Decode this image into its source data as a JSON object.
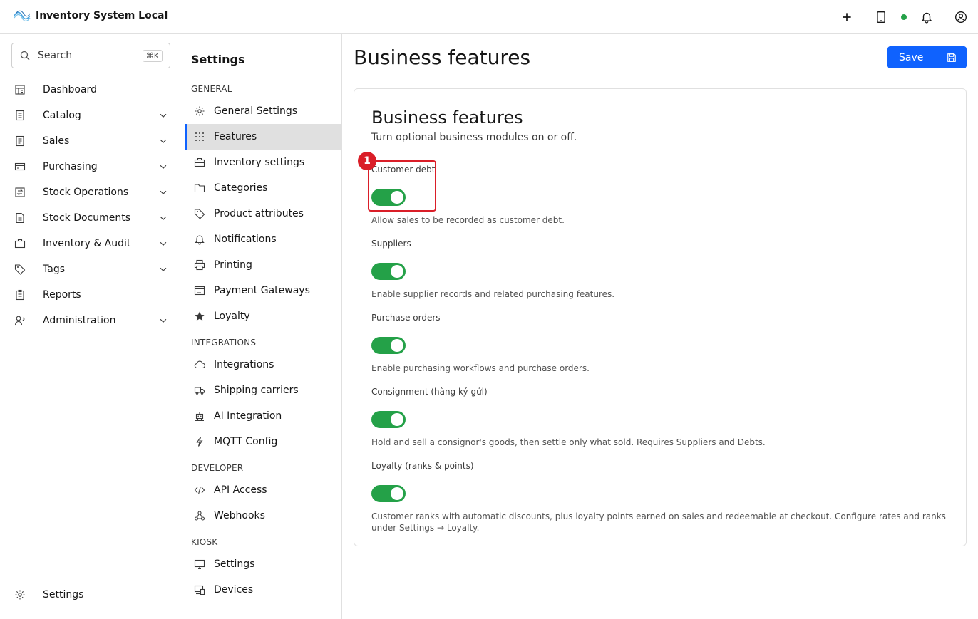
{
  "app": {
    "title": "Inventory System Local",
    "logo_icon": "brand-logo-icon"
  },
  "header": {
    "actions": [
      {
        "name": "add-icon"
      },
      {
        "name": "tablet-icon"
      },
      {
        "name": "status-online-indicator",
        "color": "#24a148"
      },
      {
        "name": "bell-icon"
      },
      {
        "name": "user-avatar-icon"
      }
    ]
  },
  "search": {
    "placeholder": "Search",
    "shortcut": "⌘K"
  },
  "sidebar": {
    "items": [
      {
        "label": "Dashboard",
        "icon": "dashboard-icon",
        "expandable": false
      },
      {
        "label": "Catalog",
        "icon": "catalog-icon",
        "expandable": true
      },
      {
        "label": "Sales",
        "icon": "sales-icon",
        "expandable": true
      },
      {
        "label": "Purchasing",
        "icon": "purchasing-icon",
        "expandable": true
      },
      {
        "label": "Stock Operations",
        "icon": "stock-operations-icon",
        "expandable": true
      },
      {
        "label": "Stock Documents",
        "icon": "document-icon",
        "expandable": true
      },
      {
        "label": "Inventory & Audit",
        "icon": "inventory-icon",
        "expandable": true
      },
      {
        "label": "Tags",
        "icon": "tag-icon",
        "expandable": true
      },
      {
        "label": "Reports",
        "icon": "report-icon",
        "expandable": false
      },
      {
        "label": "Administration",
        "icon": "admin-icon",
        "expandable": true
      }
    ],
    "footer": {
      "label": "Settings",
      "icon": "gear-icon"
    }
  },
  "settings_nav": {
    "title": "Settings",
    "groups": [
      {
        "label": "GENERAL",
        "items": [
          {
            "label": "General Settings",
            "icon": "gear-icon"
          },
          {
            "label": "Features",
            "icon": "grid-icon",
            "active": true
          },
          {
            "label": "Inventory settings",
            "icon": "inventory-icon"
          },
          {
            "label": "Categories",
            "icon": "folder-icon"
          },
          {
            "label": "Product attributes",
            "icon": "tag-icon"
          },
          {
            "label": "Notifications",
            "icon": "bell-icon"
          },
          {
            "label": "Printing",
            "icon": "printer-icon"
          },
          {
            "label": "Payment Gateways",
            "icon": "payment-icon"
          },
          {
            "label": "Loyalty",
            "icon": "star-icon"
          }
        ]
      },
      {
        "label": "INTEGRATIONS",
        "items": [
          {
            "label": "Integrations",
            "icon": "cloud-icon"
          },
          {
            "label": "Shipping carriers",
            "icon": "truck-icon"
          },
          {
            "label": "AI Integration",
            "icon": "robot-icon"
          },
          {
            "label": "MQTT Config",
            "icon": "lightning-icon"
          }
        ]
      },
      {
        "label": "DEVELOPER",
        "items": [
          {
            "label": "API Access",
            "icon": "code-icon"
          },
          {
            "label": "Webhooks",
            "icon": "webhook-icon"
          }
        ]
      },
      {
        "label": "KIOSK",
        "items": [
          {
            "label": "Settings",
            "icon": "monitor-icon"
          },
          {
            "label": "Devices",
            "icon": "devices-icon"
          }
        ]
      }
    ]
  },
  "main": {
    "page_title": "Business features",
    "save_label": "Save",
    "card": {
      "title": "Business features",
      "subtitle": "Turn optional business modules on or off.",
      "features": [
        {
          "label": "Customer debt",
          "enabled": true,
          "description": "Allow sales to be recorded as customer debt."
        },
        {
          "label": "Suppliers",
          "enabled": true,
          "description": "Enable supplier records and related purchasing features."
        },
        {
          "label": "Purchase orders",
          "enabled": true,
          "description": "Enable purchasing workflows and purchase orders."
        },
        {
          "label": "Consignment (hàng ký gửi)",
          "enabled": true,
          "description": "Hold and sell a consignor's goods, then settle only what sold. Requires Suppliers and Debts."
        },
        {
          "label": "Loyalty (ranks & points)",
          "enabled": true,
          "description": "Customer ranks with automatic discounts, plus loyalty points earned on sales and redeemable at checkout. Configure rates and ranks under Settings → Loyalty."
        }
      ]
    },
    "annotation": {
      "marker": "1",
      "color": "#da1e28"
    }
  },
  "colors": {
    "accent": "#0f62fe",
    "toggle_on": "#24a148",
    "annotation": "#da1e28"
  }
}
